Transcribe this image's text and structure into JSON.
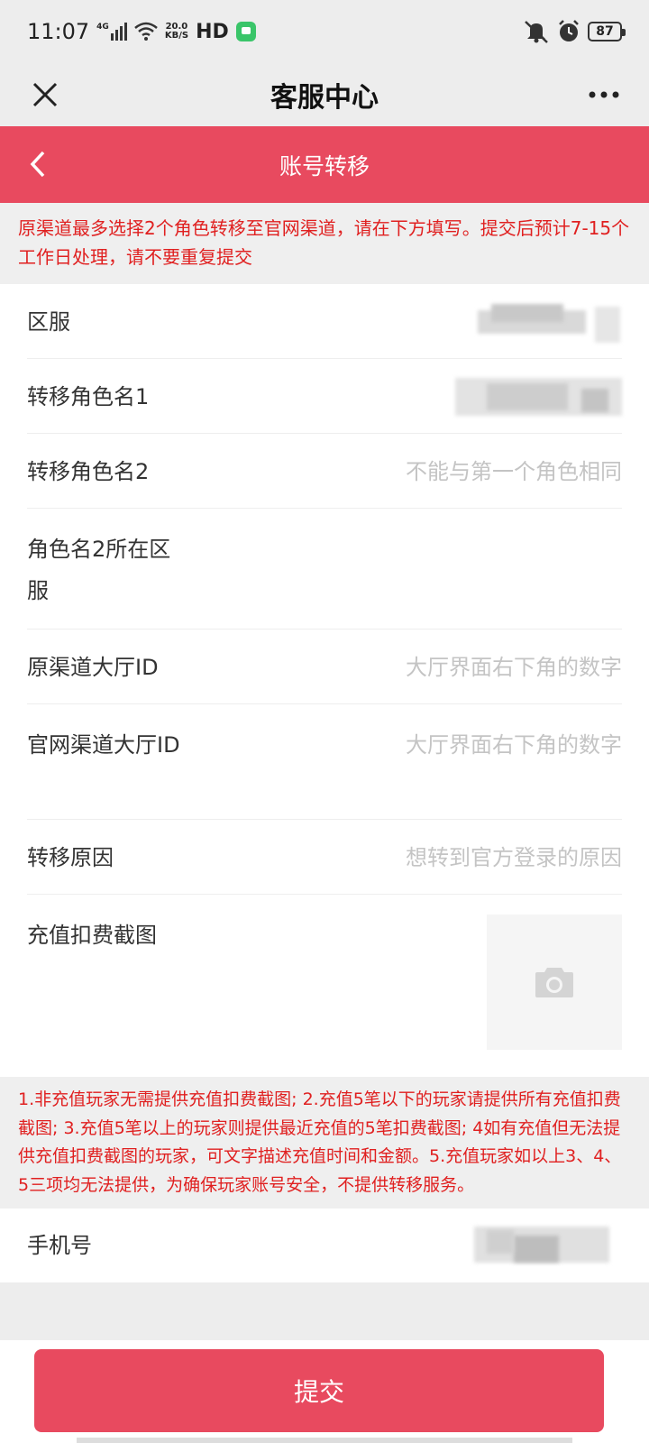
{
  "status_bar": {
    "time": "11:07",
    "signal": "4G",
    "net_speed_value": "20.0",
    "net_speed_unit": "KB/S",
    "hd": "HD",
    "battery": "87"
  },
  "nav": {
    "title": "客服中心"
  },
  "header": {
    "title": "账号转移"
  },
  "notice_top": "原渠道最多选择2个角色转移至官网渠道，请在下方填写。提交后预计7-15个工作日处理，请不要重复提交",
  "form": {
    "server": {
      "label": "区服"
    },
    "role1": {
      "label": "转移角色名1"
    },
    "role2": {
      "label": "转移角色名2",
      "placeholder": "不能与第一个角色相同"
    },
    "role2_server": {
      "label": "角色名2所在区服",
      "placeholder": ""
    },
    "orig_lobby_id": {
      "label": "原渠道大厅ID",
      "placeholder": "大厅界面右下角的数字"
    },
    "official_lobby_id": {
      "label": "官网渠道大厅ID",
      "placeholder": "大厅界面右下角的数字"
    },
    "reason": {
      "label": "转移原因",
      "placeholder": "想转到官方登录的原因"
    },
    "screenshot": {
      "label": "充值扣费截图"
    }
  },
  "notice_bottom": "1.非充值玩家无需提供充值扣费截图; 2.充值5笔以下的玩家请提供所有充值扣费截图; 3.充值5笔以上的玩家则提供最近充值的5笔扣费截图; 4如有充值但无法提供充值扣费截图的玩家，可文字描述充值时间和金额。5.充值玩家如以上3、4、5三项均无法提供，为确保玩家账号安全，不提供转移服务。",
  "phone": {
    "label": "手机号"
  },
  "submit_label": "提交",
  "colors": {
    "accent": "#e84a5f",
    "warning_text": "#e02020"
  }
}
